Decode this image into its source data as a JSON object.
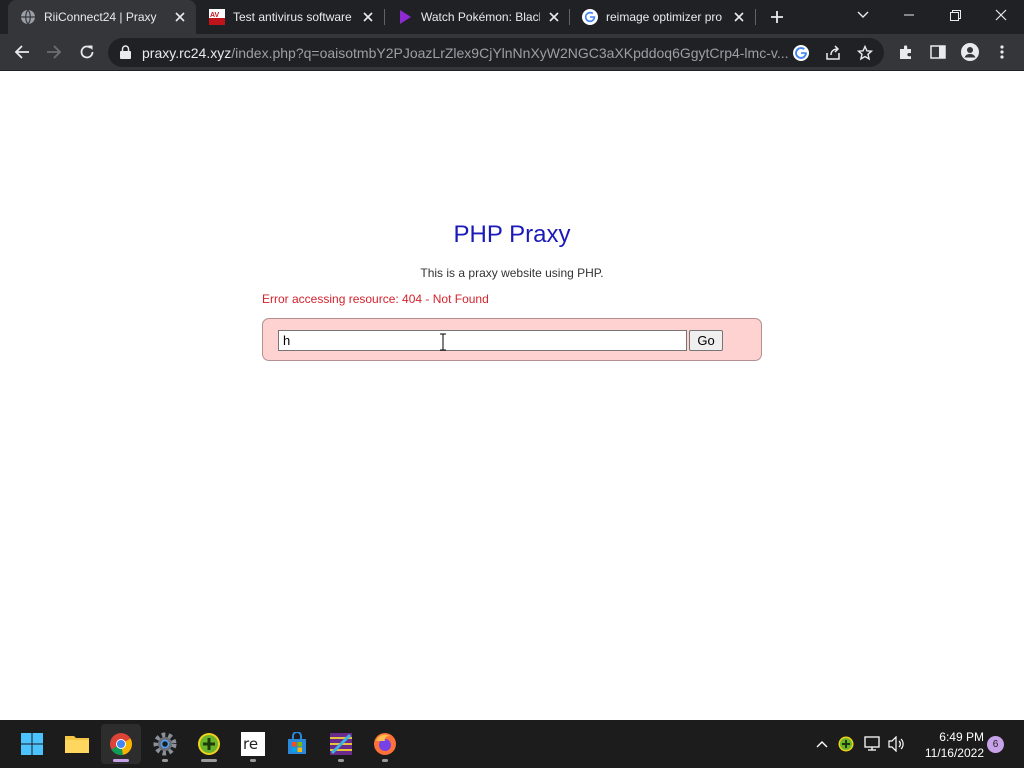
{
  "browser": {
    "tabs": [
      {
        "title": "RiiConnect24 | Praxy",
        "favicon": "globe-icon",
        "active": true
      },
      {
        "title": "Test antivirus software",
        "favicon": "av-test-icon",
        "active": false
      },
      {
        "title": "Watch Pokémon: Black",
        "favicon": "play-triangle-icon",
        "active": false
      },
      {
        "title": "reimage optimizer pro",
        "favicon": "google-icon",
        "active": false
      }
    ],
    "address": {
      "host": "praxy.rc24.xyz",
      "path": "/index.php?q=oaisotmbY2PJoazLrZlex9CjYlnNnXyW2NGC3aXKpddoq6GgytCrp4-lmc-v..."
    }
  },
  "page": {
    "title": "PHP Praxy",
    "subtitle": "This is a praxy website using PHP.",
    "error": "Error accessing resource: 404 - Not Found",
    "url_input_value": "h",
    "go_label": "Go"
  },
  "taskbar": {
    "apps": [
      "windows-start-icon",
      "file-explorer-icon",
      "chrome-icon",
      "settings-gear-icon",
      "green-plus-app-icon",
      "reimage-icon",
      "microsoft-store-icon",
      "winrar-icon",
      "firefox-icon"
    ],
    "time": "6:49 PM",
    "date": "11/16/2022",
    "notification_count": "6"
  },
  "colors": {
    "title_blue": "#1a1ab8",
    "error_red": "#d4232c",
    "form_bg": "#ffd2d2",
    "tab_dark": "#202124",
    "toolbar": "#35363a",
    "taskbar": "#1c1c1c"
  }
}
